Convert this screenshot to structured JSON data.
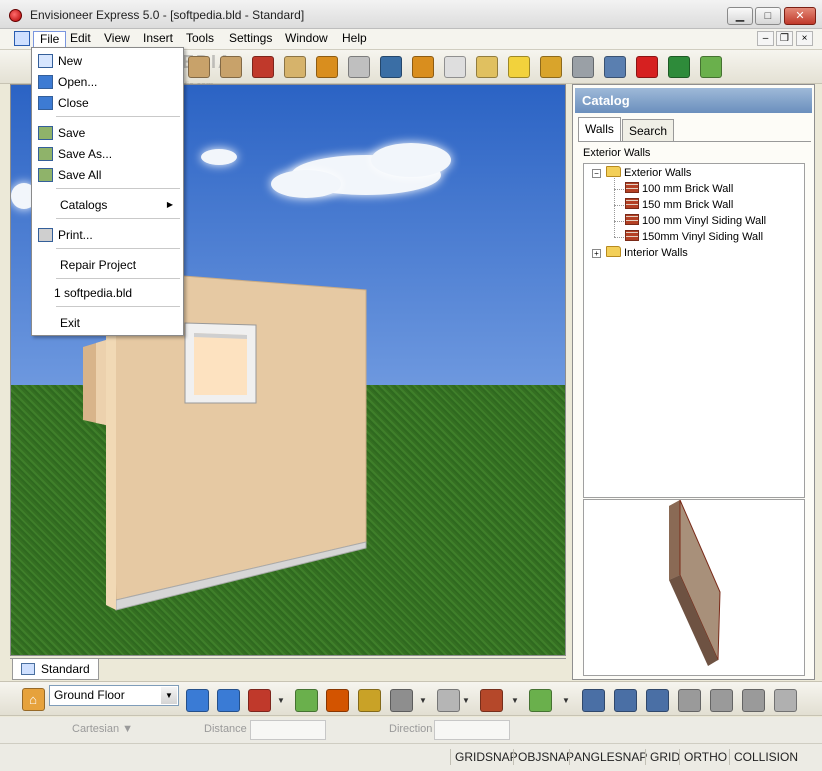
{
  "window": {
    "title": "Envisioneer Express 5.0 - [softpedia.bld - Standard]",
    "buttons": {
      "minimize": "▁",
      "maximize": "□",
      "close": "✕"
    },
    "mdi_buttons": {
      "minimize": "–",
      "restore": "❐",
      "close": "×"
    }
  },
  "menubar": {
    "items": [
      "File",
      "Edit",
      "View",
      "Insert",
      "Tools",
      "Settings",
      "Window",
      "Help"
    ],
    "active": "File"
  },
  "file_menu": {
    "new": "New",
    "open": "Open...",
    "close": "Close",
    "save": "Save",
    "save_as": "Save As...",
    "save_all": "Save All",
    "catalogs": "Catalogs",
    "print": "Print...",
    "repair": "Repair Project",
    "recent_1": "1 softpedia.bld",
    "exit": "Exit"
  },
  "toolbar": {
    "watermark": "SOFTPEDIA",
    "watermark_url": "www.softpedia.com",
    "tools": [
      {
        "icon": "wall-icon",
        "color": "#c8a26a"
      },
      {
        "icon": "floor-icon",
        "color": "#c8a26a"
      },
      {
        "icon": "roof-icon",
        "color": "#c0392b"
      },
      {
        "icon": "stairs-icon",
        "color": "#d6b36b"
      },
      {
        "icon": "door-icon",
        "color": "#d98e1e"
      },
      {
        "icon": "cabinet-icon",
        "color": "#bfbfbf"
      },
      {
        "icon": "window-icon",
        "color": "#3a6ea5"
      },
      {
        "icon": "chair-icon",
        "color": "#d98e1e"
      },
      {
        "icon": "lamp-icon",
        "color": "#dedede"
      },
      {
        "icon": "fixture-icon",
        "color": "#e0c060"
      },
      {
        "icon": "help-icon",
        "color": "#f2d23c"
      },
      {
        "icon": "catalog-book-icon",
        "color": "#d9a42b"
      },
      {
        "icon": "tools-icon",
        "color": "#9aa0a6"
      },
      {
        "icon": "person-icon",
        "color": "#5a7fb0"
      },
      {
        "icon": "undo-arrow-icon",
        "color": "#d62020"
      },
      {
        "icon": "landscape-icon",
        "color": "#2e8b3a"
      },
      {
        "icon": "import-icon",
        "color": "#6ab04c"
      }
    ]
  },
  "viewport": {
    "sky_color": "#2b63c4",
    "grass_color": "#3f7f2a",
    "wall_color": "#e6c9a3"
  },
  "view_tabs": {
    "active": "Standard"
  },
  "catalog": {
    "title": "Catalog",
    "tabs": [
      "Walls",
      "Search"
    ],
    "active_tab": "Walls",
    "category": "Exterior Walls",
    "tree": {
      "exterior": "Exterior Walls",
      "items": [
        "100 mm Brick Wall",
        "150 mm Brick Wall",
        "100 mm Vinyl Siding Wall",
        "150mm Vinyl Siding Wall"
      ],
      "interior": "Interior Walls"
    }
  },
  "bottom_toolbar": {
    "floor": "Ground Floor",
    "tools": [
      "floor-manager-icon",
      "view-2d-icon",
      "view-2d-alt-icon",
      "view-3d-icon",
      "walkthrough-icon",
      "home-icon",
      "filter-icon",
      "camera-icon",
      "fence-icon",
      "brick-icon",
      "verify-icon",
      "zoom-in-icon",
      "zoom-out-icon",
      "zoom-fit-icon",
      "zoom-window-icon",
      "zoom-pan-icon",
      "zoom-extents-icon",
      "hand-icon"
    ]
  },
  "coord_bar": {
    "mode": "Cartesian",
    "distance_label": "Distance",
    "direction_label": "Direction"
  },
  "status_bar": {
    "items": [
      "GRIDSNAP",
      "OBJSNAP",
      "ANGLESNAP",
      "GRID",
      "ORTHO",
      "COLLISION"
    ]
  }
}
